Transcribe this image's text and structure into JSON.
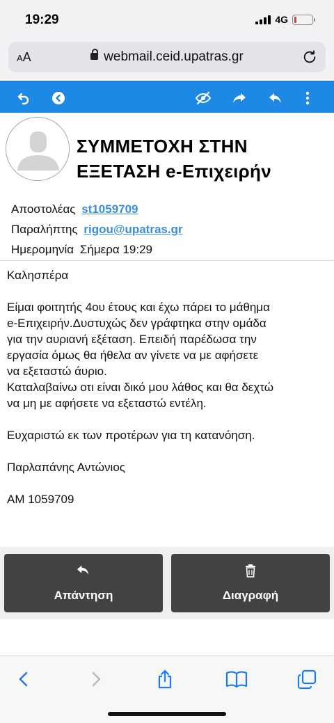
{
  "status_bar": {
    "time": "19:29",
    "network": "4G",
    "battery_percent": 12
  },
  "browser": {
    "text_size_label_small": "A",
    "text_size_label_large": "A",
    "url": "webmail.ceid.upatras.gr"
  },
  "toolbar": {
    "icons": [
      "undo-icon",
      "back-circle-icon",
      "eye-off-icon",
      "forward-icon",
      "reply-icon",
      "more-vert-icon"
    ]
  },
  "email": {
    "subject": "ΣΥΜΜΕΤΟΧΗ ΣΤΗΝ ΕΞΕΤΑΣΗ e-Επιχειρήν",
    "sender_label": "Αποστολέας",
    "sender": "st1059709",
    "recipient_label": "Παραλήπτης",
    "recipient": "rigou@upatras.gr",
    "date_label": "Ημερομηνία",
    "date": "Σήμερα 19:29",
    "greeting": "Καλησπέρα",
    "paragraph1": "Είμαι φοιτητής 4ου έτους και έχω πάρει το μάθημα\ne-Επιχειρήν.Δυστυχώς δεν γράφτηκα στην ομάδα\nγια την αυριανή εξέταση. Επειδή παρέδωσα την\nεργασία όμως θα ήθελα αν γίνετε να με αφήσετε\nνα εξεταστώ άυριο.\nΚαταλαβαίνω οτι είναι δικό μου λάθος και θα δεχτώ\nνα μη με αφήσετε να εξεταστώ εντέλη.",
    "thanks": "Ευχαριστώ εκ των προτέρων για τη κατανόηση.",
    "signature_name": "Παρλαπάνης Αντώνιος",
    "signature_id": "ΑΜ 1059709"
  },
  "actions": {
    "reply_label": "Απάντηση",
    "delete_label": "Διαγραφή"
  },
  "colors": {
    "toolbar": "#1e88e5",
    "link": "#3b8ed6",
    "action_button": "#424242",
    "safari_icon": "#1e7cf2"
  }
}
